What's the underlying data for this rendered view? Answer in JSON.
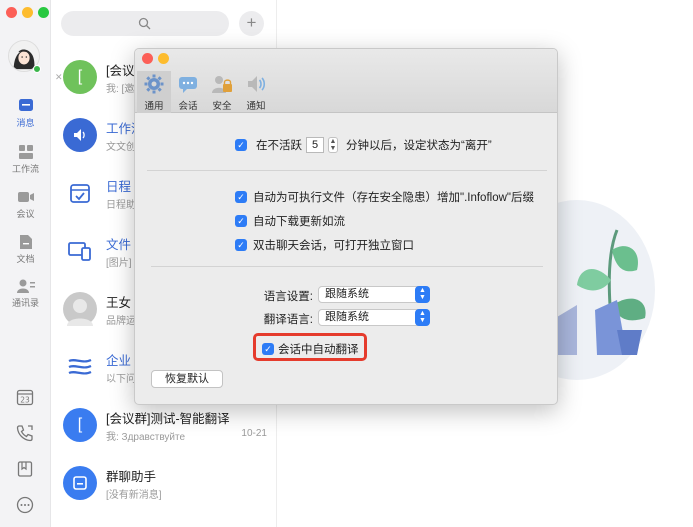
{
  "window_dots": [
    "#fc5f57",
    "#fdbc2e",
    "#28c840"
  ],
  "nav": {
    "items": [
      {
        "label": "消息",
        "icon": "message-icon",
        "active": true
      },
      {
        "label": "工作流",
        "icon": "workflow-icon",
        "active": false
      },
      {
        "label": "会议",
        "icon": "video-icon",
        "active": false
      },
      {
        "label": "文档",
        "icon": "document-icon",
        "active": false
      },
      {
        "label": "通讯录",
        "icon": "contacts-icon",
        "active": false
      }
    ],
    "bottom_icons": [
      "calendar-icon",
      "phone-icon",
      "bookmark-icon",
      "more-icon"
    ],
    "calendar_number": "23"
  },
  "list": {
    "add_label": "+",
    "conversations": [
      {
        "title": "[会议",
        "subtitle": "我: [邀",
        "time": "",
        "avatar_text": "[",
        "avatar_color": "#6fc25b"
      },
      {
        "title": "工作流",
        "subtitle": "文文创",
        "time": "",
        "avatar_text": "",
        "avatar_color": "#3a6ad4"
      },
      {
        "title": "日程",
        "subtitle": "日程助",
        "time": "",
        "avatar_text": "",
        "avatar_color": "#ffffff"
      },
      {
        "title": "文件",
        "subtitle": "[图片]",
        "time": "",
        "avatar_text": "",
        "avatar_color": "#ffffff"
      },
      {
        "title": "王女",
        "subtitle": "品牌运",
        "time": "",
        "avatar_text": "",
        "avatar_color": "#c9c9c9"
      },
      {
        "title": "企业",
        "subtitle": "以下问",
        "time": "",
        "avatar_text": "",
        "avatar_color": "#ffffff"
      },
      {
        "title": "[会议群]测试-智能翻译",
        "subtitle": "我: Здравствуйте",
        "time": "10-21",
        "avatar_text": "[",
        "avatar_color": "#3a7cf0"
      },
      {
        "title": "群聊助手",
        "subtitle": "[没有新消息]",
        "time": "",
        "avatar_text": "",
        "avatar_color": "#3a7cf0"
      }
    ]
  },
  "dialog": {
    "toolbar": [
      {
        "label": "通用",
        "icon": "gear-icon",
        "selected": true
      },
      {
        "label": "会话",
        "icon": "chat-bubble-icon",
        "selected": false
      },
      {
        "label": "安全",
        "icon": "lock-icon",
        "selected": false
      },
      {
        "label": "通知",
        "icon": "speaker-icon",
        "selected": false
      }
    ],
    "idle": {
      "prefix": "在不活跃",
      "minutes": "5",
      "suffix": "分钟以后，设定状态为“离开”",
      "checked": true
    },
    "options": [
      {
        "label": "自动为可执行文件（存在安全隐患）增加\".Infoflow\"后缀",
        "checked": true
      },
      {
        "label": "自动下载更新如流",
        "checked": true
      },
      {
        "label": "双击聊天会话，可打开独立窗口",
        "checked": true
      }
    ],
    "language_label": "语言设置:",
    "language_value": "跟随系统",
    "translate_label": "翻译语言:",
    "translate_value": "跟随系统",
    "auto_translate": {
      "label": "会话中自动翻译",
      "checked": true
    },
    "reset_label": "恢复默认",
    "checkmark": "✓",
    "stepper_glyph": "▲▼"
  }
}
